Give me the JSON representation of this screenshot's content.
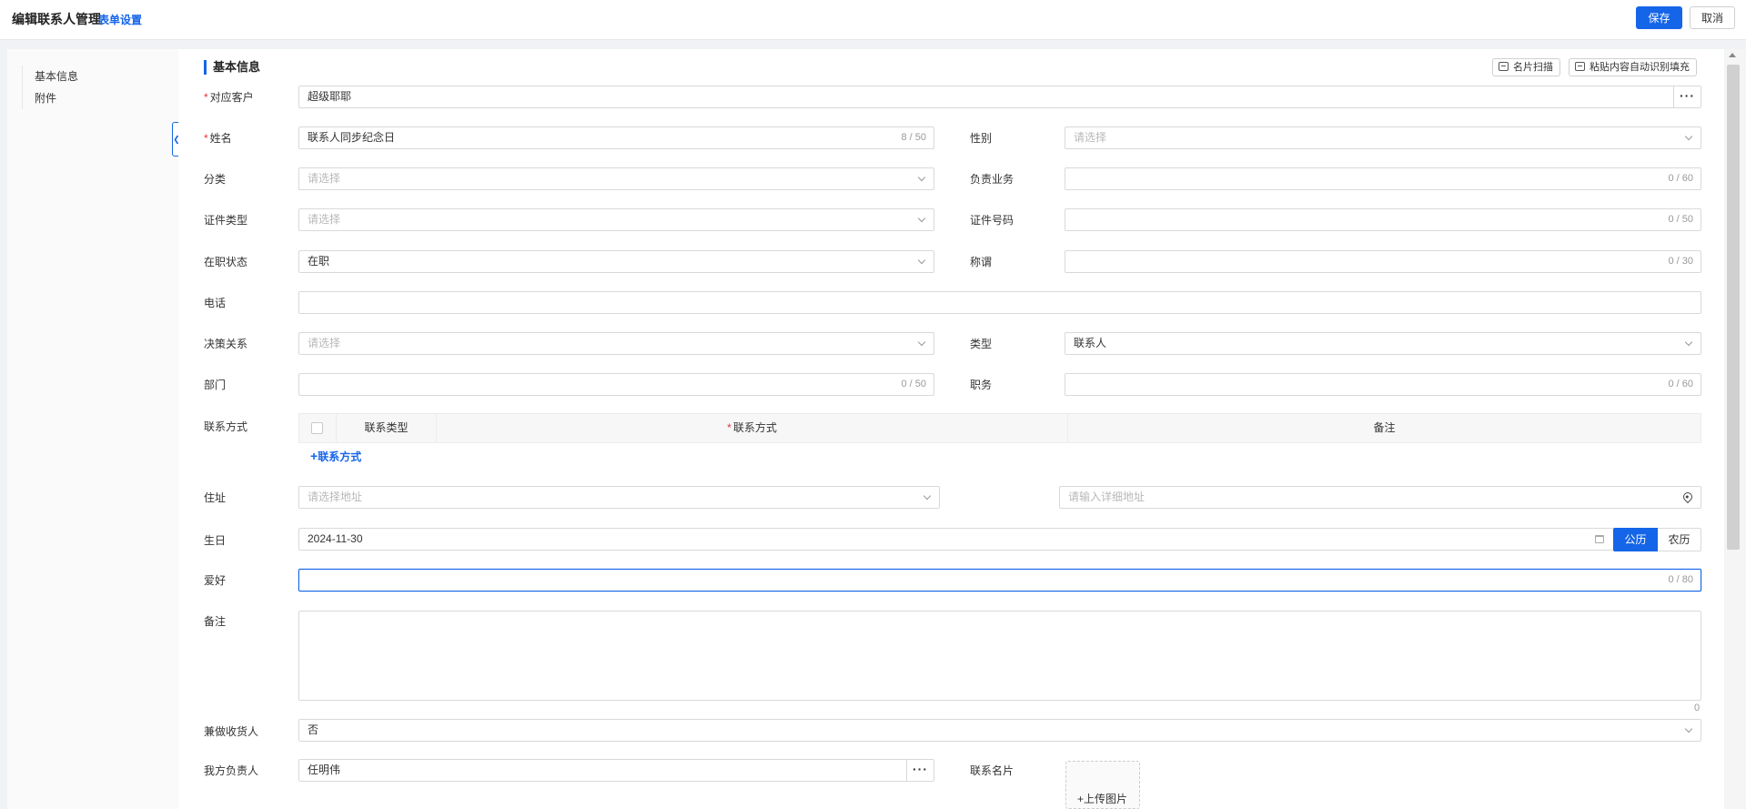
{
  "header": {
    "title": "编辑联系人管理",
    "form_settings": "表单设置",
    "save": "保存",
    "cancel": "取消"
  },
  "sidebar": {
    "items": [
      {
        "label": "基本信息"
      },
      {
        "label": "附件"
      }
    ]
  },
  "section": {
    "title": "基本信息",
    "card_scan": "名片扫描",
    "paste_fill": "粘贴内容自动识别填充"
  },
  "form": {
    "customer": {
      "label": "对应客户",
      "value": "超级耶耶"
    },
    "name": {
      "label": "姓名",
      "value": "联系人同步纪念日",
      "count": "8 / 50"
    },
    "gender": {
      "label": "性别",
      "placeholder": "请选择"
    },
    "category": {
      "label": "分类",
      "placeholder": "请选择"
    },
    "business": {
      "label": "负责业务",
      "count": "0 / 60"
    },
    "id_type": {
      "label": "证件类型",
      "placeholder": "请选择"
    },
    "id_number": {
      "label": "证件号码",
      "count": "0 / 50"
    },
    "employment": {
      "label": "在职状态",
      "value": "在职"
    },
    "appellation": {
      "label": "称谓",
      "count": "0 / 30"
    },
    "phone": {
      "label": "电话"
    },
    "decision": {
      "label": "决策关系",
      "placeholder": "请选择"
    },
    "type": {
      "label": "类型",
      "value": "联系人"
    },
    "department": {
      "label": "部门",
      "count": "0 / 50"
    },
    "position": {
      "label": "职务",
      "count": "0 / 60"
    },
    "contact_methods": {
      "label": "联系方式",
      "columns": [
        "联系类型",
        "联系方式",
        "备注"
      ],
      "add_label": "联系方式"
    },
    "address": {
      "label": "住址",
      "placeholder": "请选择地址",
      "detail_placeholder": "请输入详细地址"
    },
    "birthday": {
      "label": "生日",
      "value": "2024-11-30",
      "solar": "公历",
      "lunar": "农历"
    },
    "hobby": {
      "label": "爱好",
      "count": "0 / 80"
    },
    "remark": {
      "label": "备注",
      "count": "0"
    },
    "receiver": {
      "label": "兼做收货人",
      "value": "否"
    },
    "owner": {
      "label": "我方负责人",
      "value": "任明伟"
    },
    "card_image": {
      "label": "联系名片",
      "upload": "上传图片"
    }
  },
  "colors": {
    "primary": "#1565e8",
    "required": "#e5333a"
  }
}
